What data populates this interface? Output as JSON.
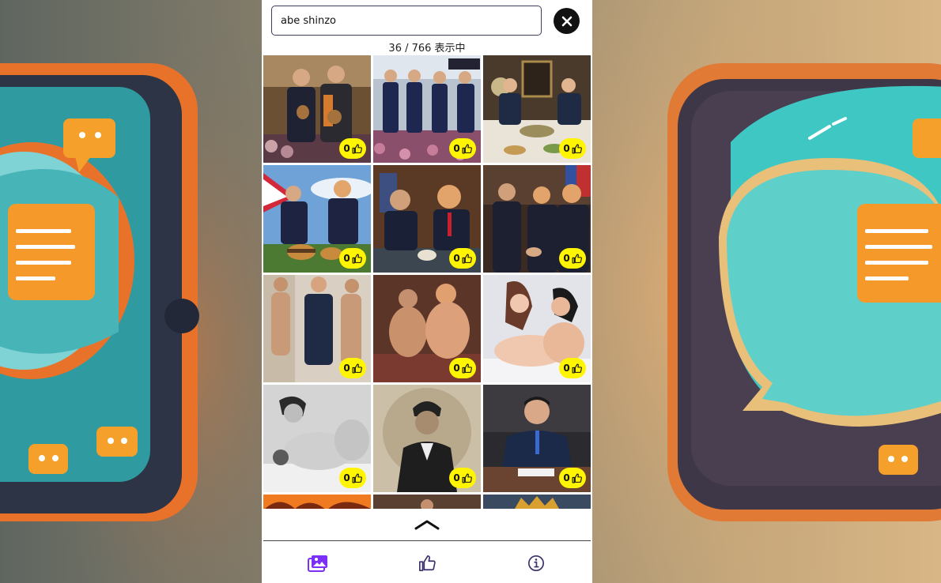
{
  "search": {
    "value": "abe shinzo",
    "placeholder": ""
  },
  "result_count": "36 / 766 表示中",
  "gallery": {
    "tiles": [
      {
        "likes": "0"
      },
      {
        "likes": "0"
      },
      {
        "likes": "0"
      },
      {
        "likes": "0"
      },
      {
        "likes": "0"
      },
      {
        "likes": "0"
      },
      {
        "likes": "0"
      },
      {
        "likes": "0"
      },
      {
        "likes": "0"
      },
      {
        "likes": "0"
      },
      {
        "likes": "0"
      },
      {
        "likes": "0"
      }
    ]
  },
  "colors": {
    "badge": "#fff500",
    "accent": "#7b2ff7",
    "nav_icon": "#3b2f6e"
  },
  "icons": {
    "clear": "close-icon",
    "like": "thumbs-up-icon",
    "scroll_top": "chevron-up-icon",
    "nav_gallery": "images-icon",
    "nav_likes": "thumbs-up-icon",
    "nav_info": "info-icon"
  }
}
